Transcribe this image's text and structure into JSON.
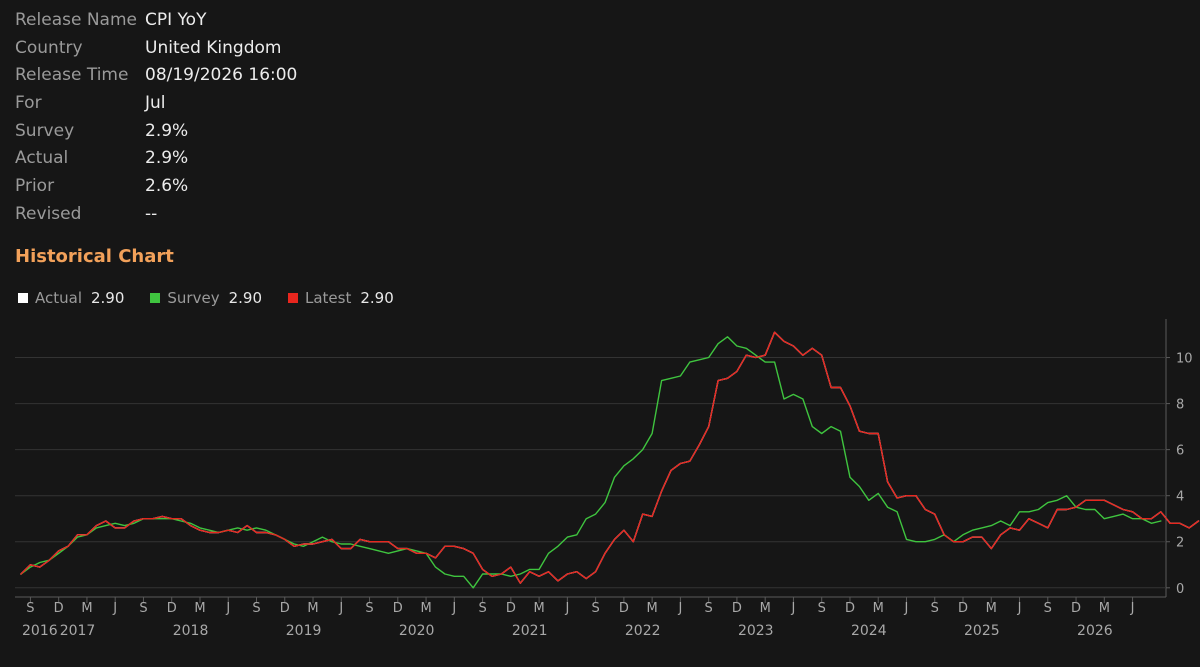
{
  "release": [
    {
      "key": "Release Name",
      "value": "CPI YoY"
    },
    {
      "key": "Country",
      "value": "United Kingdom"
    },
    {
      "key": "Release Time",
      "value": "08/19/2026 16:00"
    },
    {
      "key": "For",
      "value": "Jul"
    },
    {
      "key": "Survey",
      "value": "2.9%"
    },
    {
      "key": "Actual",
      "value": "2.9%"
    },
    {
      "key": "Prior",
      "value": "2.6%"
    },
    {
      "key": "Revised",
      "value": "--"
    }
  ],
  "section_title": "Historical Chart",
  "legend": [
    {
      "name": "Actual",
      "value": "2.90",
      "color": "#ffffff"
    },
    {
      "name": "Survey",
      "value": "2.90",
      "color": "#3fc43f"
    },
    {
      "name": "Latest",
      "value": "2.90",
      "color": "#e8261e"
    }
  ],
  "chart_data": {
    "type": "line",
    "y_ticks": [
      0,
      2,
      4,
      6,
      8,
      10
    ],
    "ylim": [
      -0.4,
      11.5
    ],
    "month_ticks": [
      "S",
      "D",
      "M",
      "J",
      "S",
      "D",
      "M",
      "J",
      "S",
      "D",
      "M",
      "J",
      "S",
      "D",
      "M",
      "J",
      "S",
      "D",
      "M",
      "J",
      "S",
      "D",
      "M",
      "J",
      "S",
      "D",
      "M",
      "J",
      "S",
      "D",
      "M",
      "J",
      "S",
      "D",
      "M",
      "J",
      "S",
      "D",
      "M",
      "J"
    ],
    "year_labels": [
      "2016",
      "2017",
      "2018",
      "2019",
      "2020",
      "2021",
      "2022",
      "2023",
      "2024",
      "2025",
      "2026"
    ],
    "x_start": "2016-08",
    "x_end": "2026-07",
    "series": [
      {
        "name": "Actual",
        "color": "#ffffff",
        "values": [
          0.6,
          1.0,
          0.9,
          1.2,
          1.6,
          1.8,
          2.3,
          2.3,
          2.7,
          2.9,
          2.6,
          2.6,
          2.9,
          3.0,
          3.0,
          3.1,
          3.0,
          3.0,
          2.7,
          2.5,
          2.4,
          2.4,
          2.5,
          2.4,
          2.7,
          2.4,
          2.4,
          2.3,
          2.1,
          1.8,
          1.9,
          1.9,
          2.0,
          2.1,
          1.7,
          1.7,
          2.1,
          2.0,
          2.0,
          2.0,
          1.7,
          1.7,
          1.5,
          1.5,
          1.3,
          1.8,
          1.8,
          1.7,
          1.5,
          0.8,
          0.5,
          0.6,
          0.9,
          0.2,
          0.7,
          0.5,
          0.7,
          0.3,
          0.6,
          0.7,
          0.4,
          0.7,
          1.5,
          2.1,
          2.5,
          2.0,
          3.2,
          3.1,
          4.2,
          5.1,
          5.4,
          5.5,
          6.2,
          7.0,
          9.0,
          9.1,
          9.4,
          10.1,
          10.0,
          10.1,
          11.1,
          10.7,
          10.5,
          10.1,
          10.4,
          10.1,
          8.7,
          8.7,
          7.9,
          6.8,
          6.7,
          6.7,
          4.6,
          3.9,
          4.0,
          4.0,
          3.4,
          3.2,
          2.3,
          2.0,
          2.0,
          2.2,
          2.2,
          1.7,
          2.3,
          2.6,
          2.5,
          3.0,
          2.8,
          2.6,
          3.4,
          3.4,
          3.5,
          3.8,
          3.8,
          3.8,
          3.6,
          3.4,
          3.3,
          3.0,
          3.0,
          3.3,
          2.8,
          2.8,
          2.6,
          2.9
        ]
      },
      {
        "name": "Survey",
        "color": "#3fc43f",
        "values": [
          0.6,
          0.9,
          1.1,
          1.2,
          1.5,
          1.8,
          2.2,
          2.3,
          2.6,
          2.7,
          2.8,
          2.7,
          2.8,
          3.0,
          3.0,
          3.0,
          3.0,
          2.9,
          2.8,
          2.6,
          2.5,
          2.4,
          2.5,
          2.6,
          2.5,
          2.6,
          2.5,
          2.3,
          2.1,
          1.9,
          1.8,
          2.0,
          2.2,
          2.0,
          1.9,
          1.9,
          1.8,
          1.7,
          1.6,
          1.5,
          1.6,
          1.7,
          1.6,
          1.5,
          0.9,
          0.6,
          0.5,
          0.5,
          0.0,
          0.6,
          0.6,
          0.6,
          0.5,
          0.6,
          0.8,
          0.8,
          1.5,
          1.8,
          2.2,
          2.3,
          3.0,
          3.2,
          3.7,
          4.8,
          5.3,
          5.6,
          6.0,
          6.7,
          9.0,
          9.1,
          9.2,
          9.8,
          9.9,
          10.0,
          10.6,
          10.9,
          10.5,
          10.4,
          10.1,
          9.8,
          9.8,
          8.2,
          8.4,
          8.2,
          7.0,
          6.7,
          7.0,
          6.8,
          4.8,
          4.4,
          3.8,
          4.1,
          3.5,
          3.3,
          2.1,
          2.0,
          2.0,
          2.1,
          2.3,
          2.0,
          2.3,
          2.5,
          2.6,
          2.7,
          2.9,
          2.7,
          3.3,
          3.3,
          3.4,
          3.7,
          3.8,
          4.0,
          3.5,
          3.4,
          3.4,
          3.0,
          3.1,
          3.2,
          3.0,
          3.0,
          2.8,
          2.9
        ]
      },
      {
        "name": "Latest",
        "color": "#e8261e",
        "values": [
          0.6,
          1.0,
          0.9,
          1.2,
          1.6,
          1.8,
          2.3,
          2.3,
          2.7,
          2.9,
          2.6,
          2.6,
          2.9,
          3.0,
          3.0,
          3.1,
          3.0,
          3.0,
          2.7,
          2.5,
          2.4,
          2.4,
          2.5,
          2.4,
          2.7,
          2.4,
          2.4,
          2.3,
          2.1,
          1.8,
          1.9,
          1.9,
          2.0,
          2.1,
          1.7,
          1.7,
          2.1,
          2.0,
          2.0,
          2.0,
          1.7,
          1.7,
          1.5,
          1.5,
          1.3,
          1.8,
          1.8,
          1.7,
          1.5,
          0.8,
          0.5,
          0.6,
          0.9,
          0.2,
          0.7,
          0.5,
          0.7,
          0.3,
          0.6,
          0.7,
          0.4,
          0.7,
          1.5,
          2.1,
          2.5,
          2.0,
          3.2,
          3.1,
          4.2,
          5.1,
          5.4,
          5.5,
          6.2,
          7.0,
          9.0,
          9.1,
          9.4,
          10.1,
          10.0,
          10.1,
          11.1,
          10.7,
          10.5,
          10.1,
          10.4,
          10.1,
          8.7,
          8.7,
          7.9,
          6.8,
          6.7,
          6.7,
          4.6,
          3.9,
          4.0,
          4.0,
          3.4,
          3.2,
          2.3,
          2.0,
          2.0,
          2.2,
          2.2,
          1.7,
          2.3,
          2.6,
          2.5,
          3.0,
          2.8,
          2.6,
          3.4,
          3.4,
          3.5,
          3.8,
          3.8,
          3.8,
          3.6,
          3.4,
          3.3,
          3.0,
          3.0,
          3.3,
          2.8,
          2.8,
          2.6,
          2.9
        ]
      }
    ]
  }
}
